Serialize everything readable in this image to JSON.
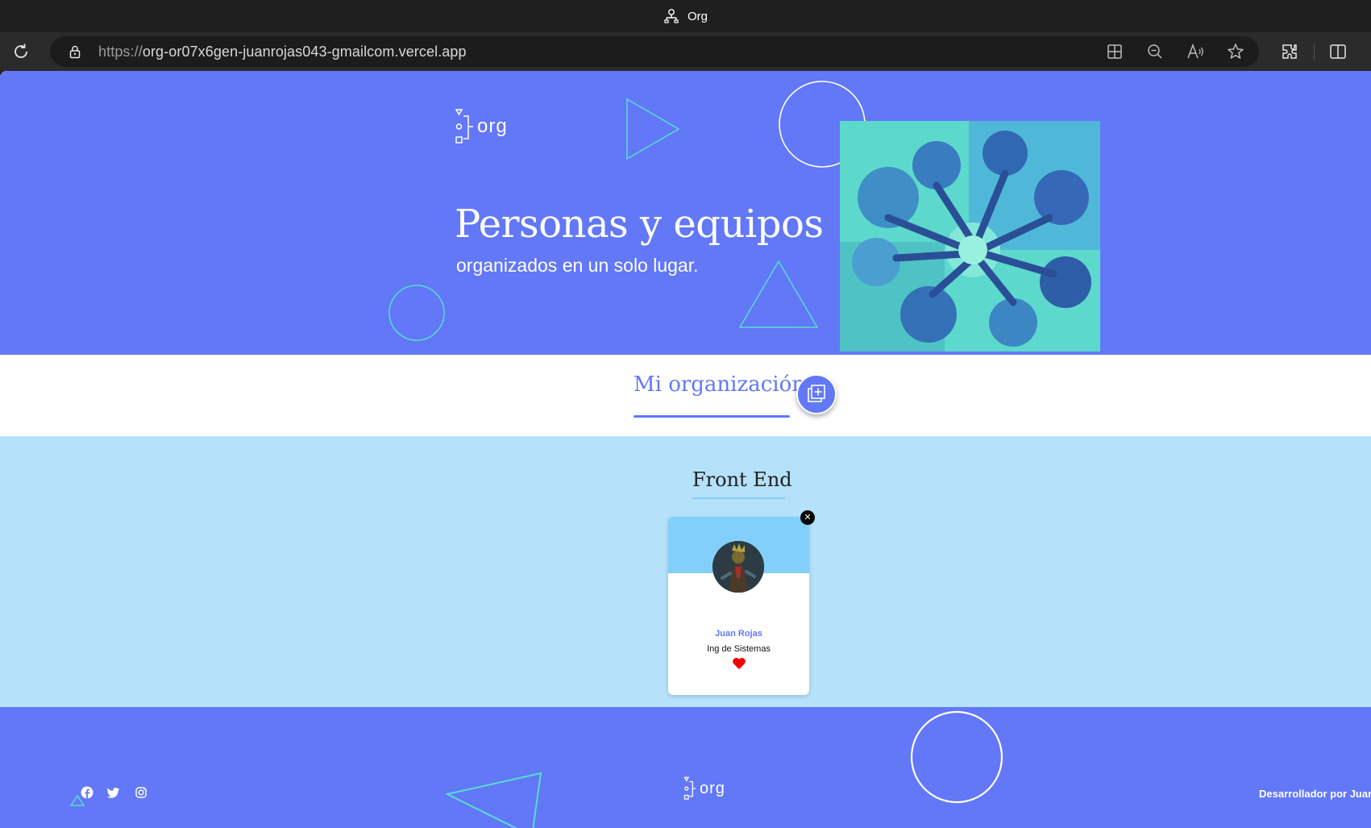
{
  "browser": {
    "tab_title": "Org",
    "url_protocol": "https://",
    "url_host": "org-or07x6gen-juanrojas043-gmailcom.vercel.app"
  },
  "hero": {
    "logo_text": "org",
    "title": "Personas y equipos",
    "subtitle": "organizados en un solo lugar."
  },
  "organization": {
    "title": "Mi organización"
  },
  "teams": [
    {
      "title": "Front End",
      "members": [
        {
          "name": "Juan Rojas",
          "role": "Ing de Sistemas",
          "favorite": true,
          "delete_symbol": "✕"
        }
      ]
    }
  ],
  "footer": {
    "logo_text": "org",
    "credit": "Desarrollador por Juan",
    "social": [
      "facebook-icon",
      "twitter-icon",
      "instagram-icon"
    ]
  },
  "colors": {
    "primary": "#6278f7",
    "team_bg": "#b5e1fa",
    "team_accent": "#82cffa",
    "shape_teal": "#58dcd0"
  }
}
